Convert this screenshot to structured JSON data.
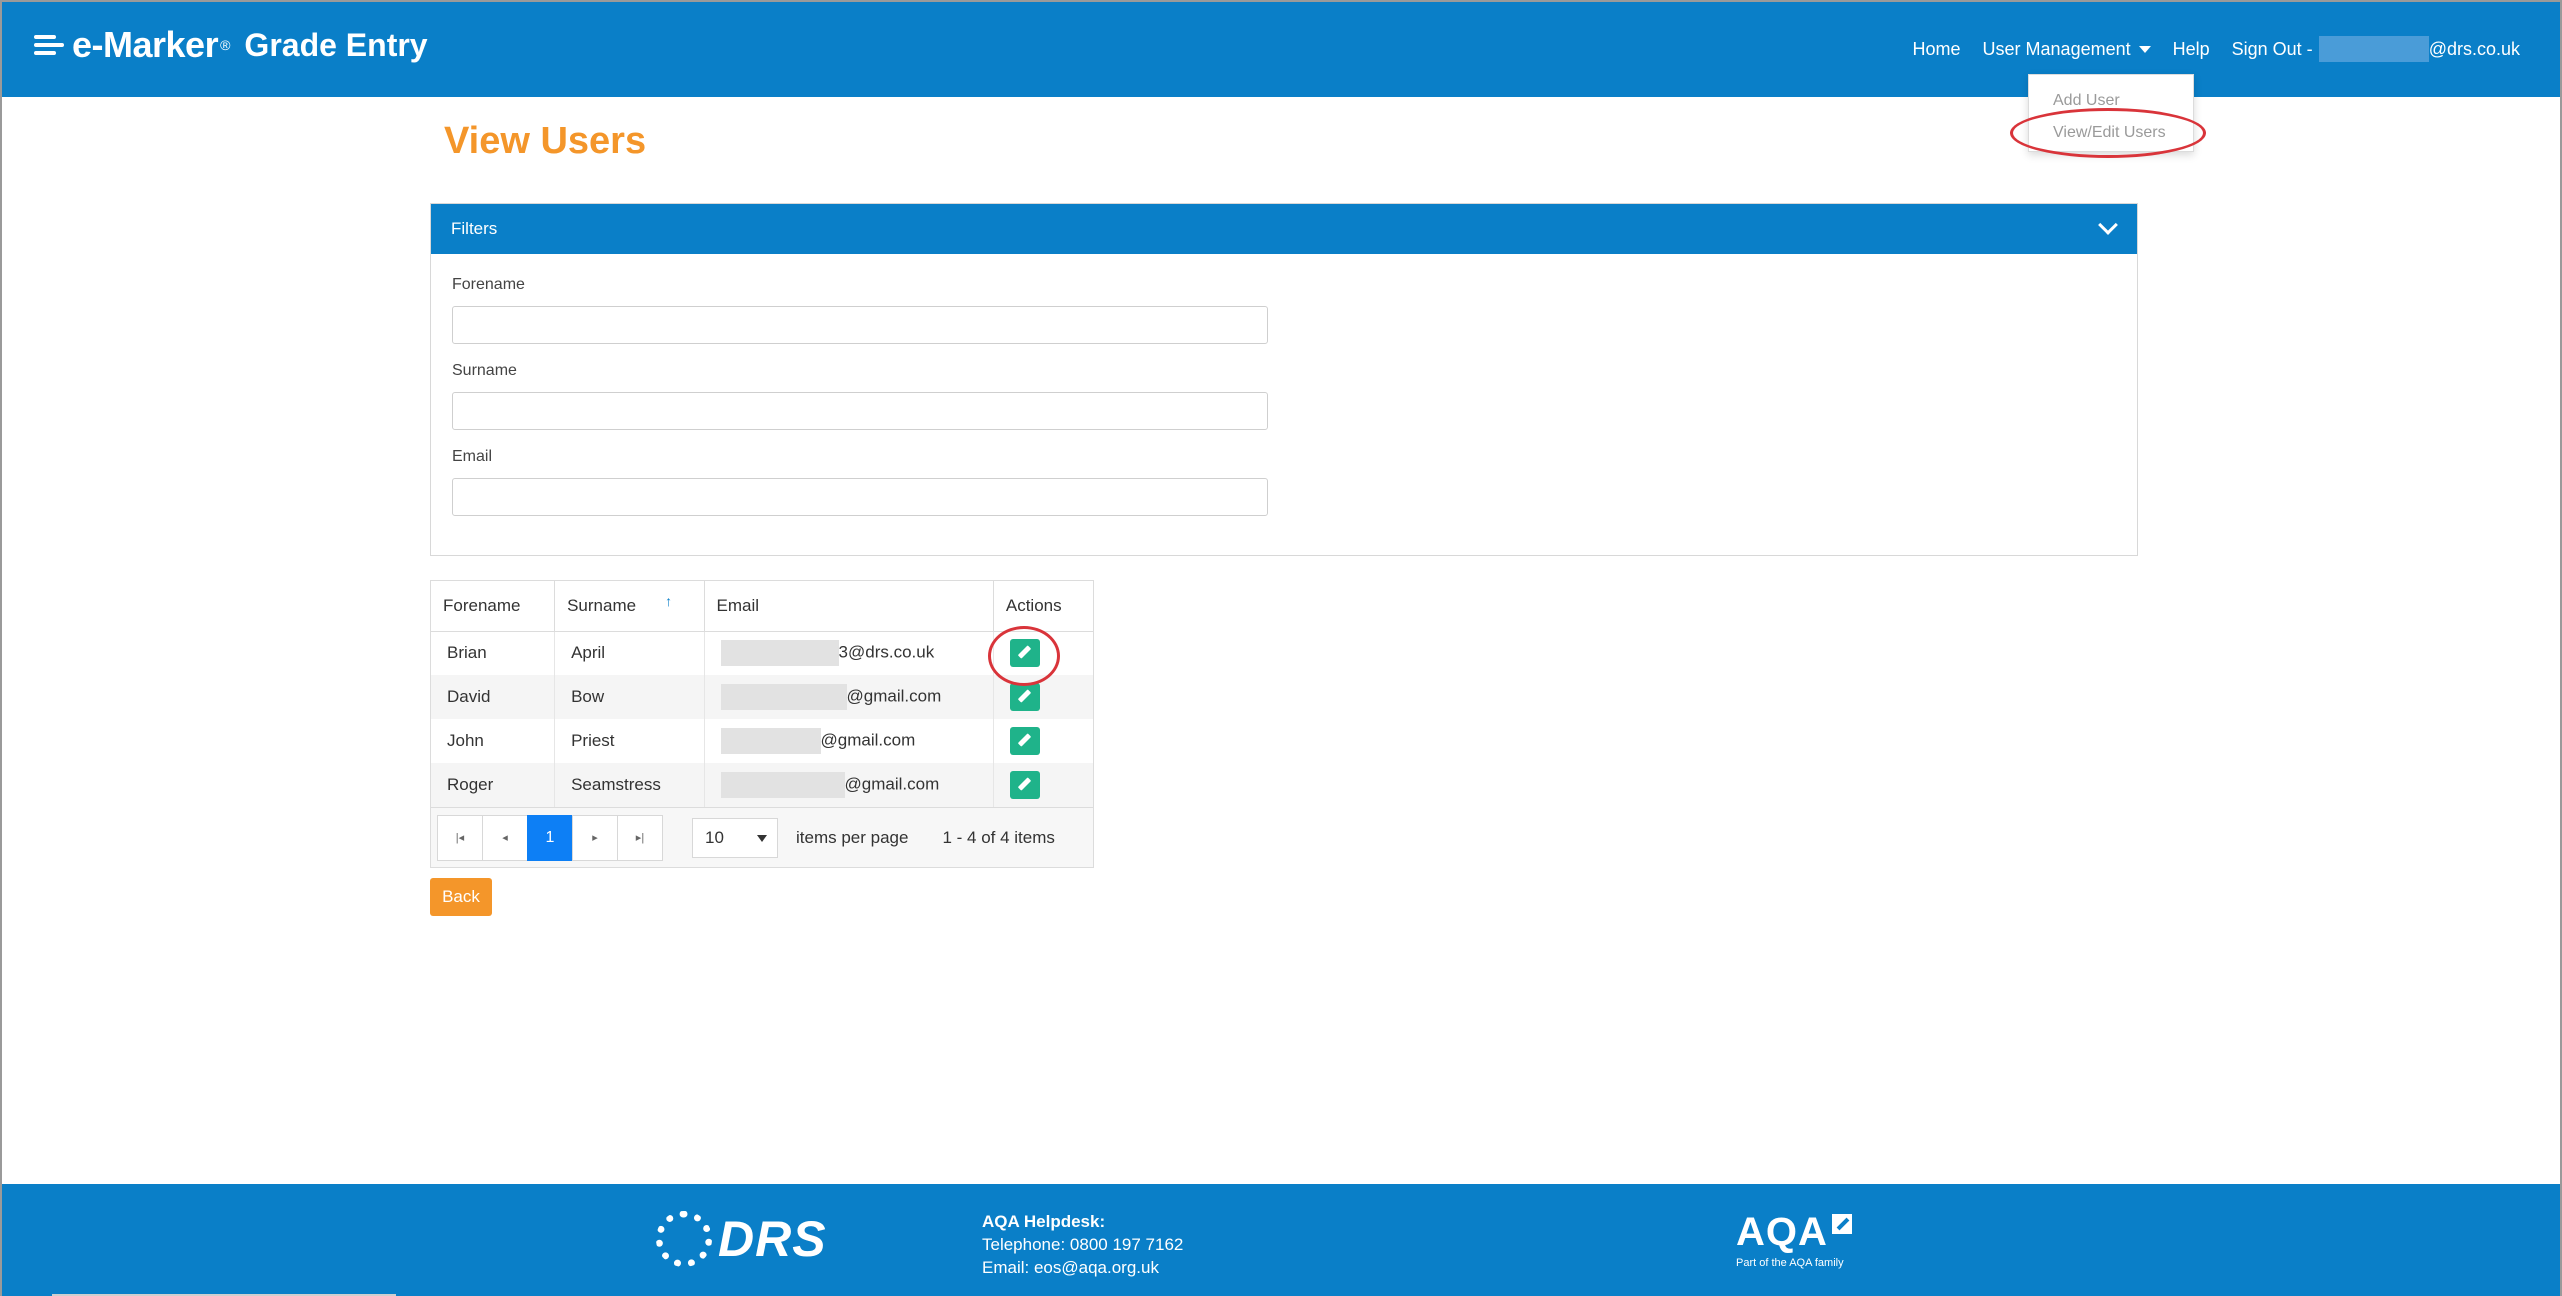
{
  "header": {
    "brand_name": "e-Marker",
    "brand_reg": "®",
    "product": "Grade Entry",
    "nav": {
      "home": "Home",
      "user_management": "User Management",
      "help": "Help",
      "sign_out": "Sign Out -",
      "sign_out_domain": "@drs.co.uk"
    }
  },
  "dropdown": {
    "items": [
      "Add User",
      "View/Edit Users"
    ]
  },
  "page": {
    "title": "View Users"
  },
  "filters": {
    "title": "Filters",
    "fields": [
      {
        "label": "Forename",
        "value": ""
      },
      {
        "label": "Surname",
        "value": ""
      },
      {
        "label": "Email",
        "value": ""
      }
    ]
  },
  "grid": {
    "columns": [
      "Forename",
      "Surname",
      "Email",
      "Actions"
    ],
    "sort_indicator": "↑",
    "rows": [
      {
        "forename": "Brian",
        "surname": "April",
        "email_suffix": "3@drs.co.uk"
      },
      {
        "forename": "David",
        "surname": "Bow",
        "email_suffix": "@gmail.com"
      },
      {
        "forename": "John",
        "surname": "Priest",
        "email_suffix": "@gmail.com"
      },
      {
        "forename": "Roger",
        "surname": "Seamstress",
        "email_suffix": "@gmail.com"
      }
    ],
    "pager": {
      "current_page": "1",
      "page_size": "10",
      "items_per_page_label": "items per page",
      "info": "1 - 4 of 4 items"
    }
  },
  "actions": {
    "back": "Back"
  },
  "footer": {
    "drs_logo": "DRS",
    "helpdesk_title": "AQA Helpdesk:",
    "telephone": "Telephone: 0800 197 7162",
    "email": "Email: eos@aqa.org.uk",
    "aqa_logo": "AQA",
    "aqa_tagline": "Part of the AQA family"
  },
  "colors": {
    "header_blue": "#0a7fc8",
    "title_orange": "#f4962a",
    "edit_green": "#1fb38a",
    "pager_active": "#0d7ff5",
    "annotation_red": "#d9343a"
  },
  "icons": {
    "brand": "hamburger-lines-icon",
    "filters_toggle": "chevron-down-icon",
    "edit": "pencil-icon",
    "first": "first-page-icon",
    "prev": "prev-page-icon",
    "next": "next-page-icon",
    "last": "last-page-icon"
  }
}
